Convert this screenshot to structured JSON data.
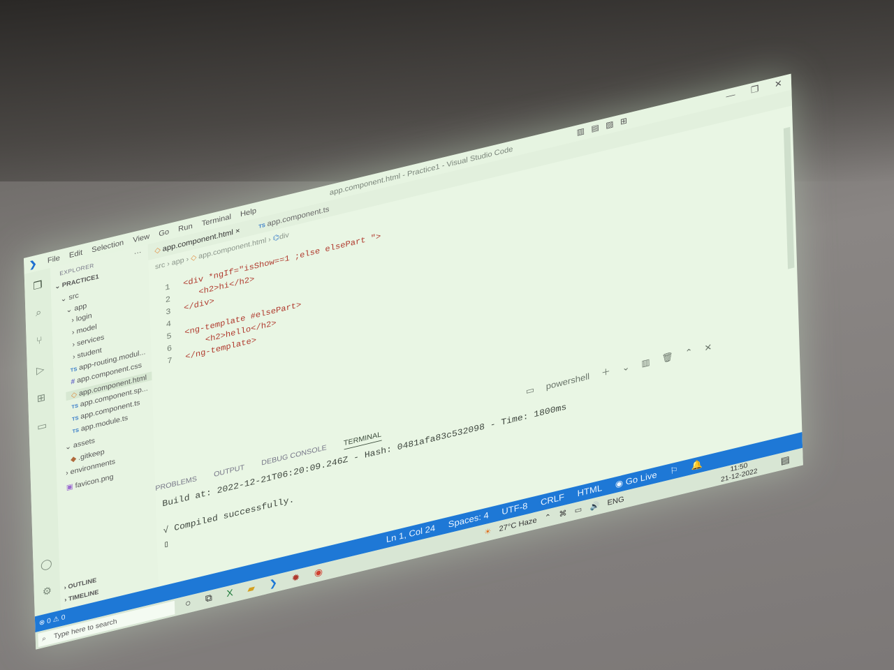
{
  "window": {
    "title": "app.component.html - Practice1 - Visual Studio Code",
    "menu": [
      "File",
      "Edit",
      "Selection",
      "View",
      "Go",
      "Run",
      "Terminal",
      "Help"
    ]
  },
  "sidebar": {
    "header": "EXPLORER",
    "project": "PRACTICE1",
    "items": [
      {
        "label": "src",
        "type": "folder-open"
      },
      {
        "label": "app",
        "type": "folder-open"
      },
      {
        "label": "login",
        "type": "folder"
      },
      {
        "label": "model",
        "type": "folder"
      },
      {
        "label": "services",
        "type": "folder"
      },
      {
        "label": "student",
        "type": "folder"
      },
      {
        "label": "app-routing.modul...",
        "type": "ts"
      },
      {
        "label": "app.component.css",
        "type": "css"
      },
      {
        "label": "app.component.html",
        "type": "html",
        "selected": true
      },
      {
        "label": "app.component.sp...",
        "type": "ts"
      },
      {
        "label": "app.component.ts",
        "type": "ts"
      },
      {
        "label": "app.module.ts",
        "type": "ts"
      },
      {
        "label": "assets",
        "type": "folder-open"
      },
      {
        "label": ".gitkeep",
        "type": "git"
      },
      {
        "label": "environments",
        "type": "folder"
      },
      {
        "label": "favicon.png",
        "type": "img"
      }
    ],
    "outline": "OUTLINE",
    "timeline": "TIMELINE"
  },
  "tabs": [
    {
      "label": "app.component.html",
      "active": true,
      "close": "×"
    },
    {
      "label": "app.component.ts",
      "active": false
    }
  ],
  "breadcrumb": [
    "src",
    "app",
    "app.component.html",
    "div"
  ],
  "editor": {
    "lines": [
      {
        "num": "1",
        "code": "<div *ngIf=\"isShow==1 ;else elsePart \">"
      },
      {
        "num": "2",
        "code": "   <h2>hi</h2>"
      },
      {
        "num": "3",
        "code": "</div>"
      },
      {
        "num": "4",
        "code": ""
      },
      {
        "num": "5",
        "code": "<ng-template #elsePart>"
      },
      {
        "num": "6",
        "code": "    <h2>hello</h2>"
      },
      {
        "num": "7",
        "code": "</ng-template>"
      }
    ]
  },
  "panel": {
    "tabs": [
      "PROBLEMS",
      "OUTPUT",
      "DEBUG CONSOLE",
      "TERMINAL"
    ],
    "active_tab": "TERMINAL",
    "shell": "powershell",
    "terminal_lines": [
      "Build at: 2022-12-21T06:20:09.246Z - Hash: 0481afa83c532098 - Time: 1800ms",
      "√ Compiled successfully."
    ]
  },
  "statusbar": {
    "problems": "⊗ 0 ⚠ 0",
    "position": "Ln 1, Col 24",
    "spaces": "Spaces: 4",
    "encoding": "UTF-8",
    "eol": "CRLF",
    "language": "HTML",
    "golive": "Go Live"
  },
  "taskbar": {
    "search_placeholder": "Type here to search",
    "weather": "27°C Haze",
    "lang": "ENG",
    "time": "11:50",
    "date": "21-12-2022"
  },
  "colors": {
    "statusbar": "#1e78d6",
    "editor_bg": "#e9f6e4",
    "tag": "#b03a2e",
    "attribute": "#c06a2e",
    "string": "#2a6a9a",
    "keyword": "#9b3aa0"
  }
}
